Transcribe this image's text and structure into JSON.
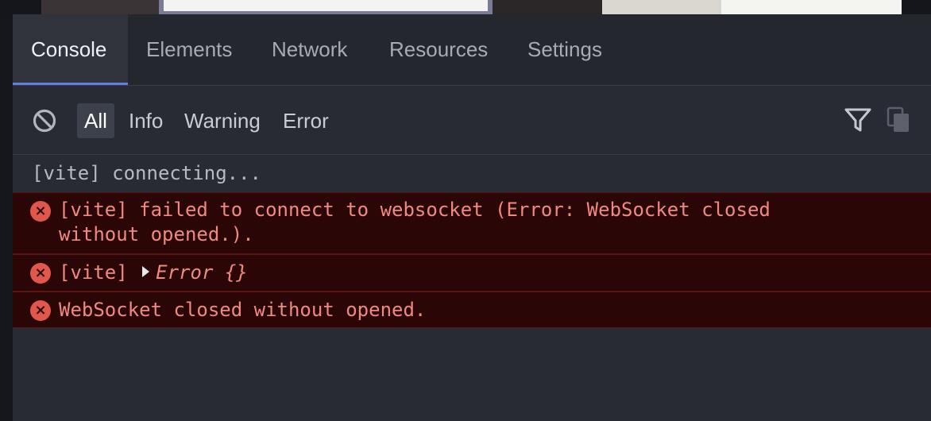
{
  "tabs": [
    "Console",
    "Elements",
    "Network",
    "Resources",
    "Settings"
  ],
  "active_tab": "Console",
  "filters": [
    "All",
    "Info",
    "Warning",
    "Error"
  ],
  "active_filter": "All",
  "logs": {
    "connecting": "[vite] connecting...",
    "ws_fail_line1": "[vite] failed to connect to websocket (Error: WebSocket closed",
    "ws_fail_line2": "without opened.).",
    "error_obj_prefix": "[vite]",
    "error_obj_value": "Error {}",
    "ws_closed": "WebSocket closed without opened."
  },
  "icons": {
    "clear": "clear-console-icon",
    "filter": "funnel-icon",
    "copy": "copy-icon",
    "error": "error-x-icon",
    "expand": "expand-triangle-icon"
  },
  "colors": {
    "accent": "#5f7fe6",
    "error_bg": "#2a0606",
    "error_text": "#f08a80",
    "error_icon": "#e0574d"
  }
}
